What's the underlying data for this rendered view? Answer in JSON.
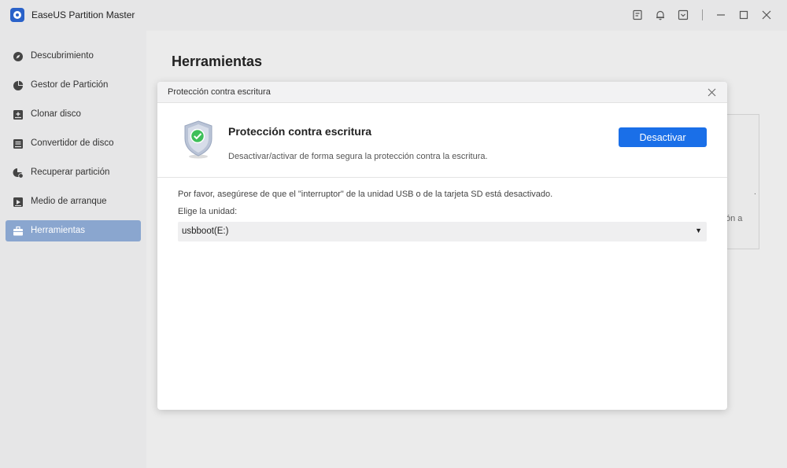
{
  "app": {
    "title": "EaseUS Partition Master"
  },
  "sidebar": {
    "items": [
      {
        "label": "Descubrimiento",
        "icon": "compass-icon",
        "active": false
      },
      {
        "label": "Gestor de Partición",
        "icon": "pie-chart-icon",
        "active": false
      },
      {
        "label": "Clonar disco",
        "icon": "clone-disk-icon",
        "active": false
      },
      {
        "label": "Convertidor de disco",
        "icon": "disk-converter-icon",
        "active": false
      },
      {
        "label": "Recuperar partición",
        "icon": "recover-partition-icon",
        "active": false
      },
      {
        "label": "Medio de arranque",
        "icon": "bootable-media-icon",
        "active": false
      },
      {
        "label": "Herramientas",
        "icon": "toolbox-icon",
        "active": true
      }
    ]
  },
  "main": {
    "title": "Herramientas",
    "background_card": {
      "fragment": "ón a",
      "dot": "."
    }
  },
  "dialog": {
    "title": "Protección contra escritura",
    "feature_title": "Protección contra escritura",
    "feature_description": "Desactivar/activar de forma segura la protección contra la escritura.",
    "action_button": "Desactivar",
    "note": "Por favor, asegúrese de que el \"interruptor\" de la unidad USB o de la tarjeta SD está desactivado.",
    "drive_label": "Elige la unidad:",
    "drive_value": "usbboot(E:)",
    "dropdown_arrow": "▼"
  },
  "colors": {
    "accent": "#1a6fe8",
    "active_nav": "#8aa6cf",
    "shield_check": "#3fbf5a"
  }
}
